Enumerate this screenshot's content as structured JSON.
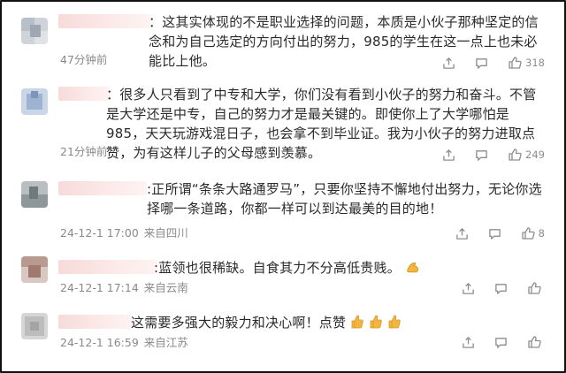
{
  "comments": [
    {
      "prefix": "：",
      "text": "这其实体现的不是职业选择的问题，本质是小伙子那种坚定的信念和为自己选定的方向付出的努力，985的学生在这一点上也未必能比上他。",
      "time": "47分钟前",
      "location": "",
      "likes": "318"
    },
    {
      "prefix": "：",
      "text": "很多人只看到了中专和大学，你们没有看到小伙子的努力和奋斗。不管是大学还是中专，自己的努力才是最关键的。即使你上了大学哪怕是985，天天玩游戏混日子，也会拿不到毕业证。我为小伙子的努力进取点赞，为有这样儿子的父母感到羡慕。",
      "time": "21分钟前",
      "location": "",
      "likes": "249"
    },
    {
      "prefix": ":",
      "text": "正所谓“条条大路通罗马”，只要你坚持不懈地付出努力，无论你选择哪一条道路，你都一样可以到达最美的目的地！",
      "time": "24-12-1 17:00",
      "location": "来自四川",
      "likes": "8"
    },
    {
      "prefix": ":",
      "text": "蓝领也很稀缺。自食其力不分高低贵贱。",
      "time": "24-12-1 17:14",
      "location": "来自云南",
      "likes": ""
    },
    {
      "prefix": "",
      "text": "这需要多强大的毅力和决心啊！点赞",
      "time": "24-12-1 16:59",
      "location": "来自江苏",
      "likes": ""
    }
  ],
  "icons": {
    "share": "share-icon",
    "reply": "comment-icon",
    "like": "thumbs-up-icon",
    "emoji_muscle": "flexed-biceps-emoji",
    "emoji_thumbs": "thumbs-up-emoji"
  },
  "colors": {
    "name_blur": "#f6d9d7",
    "meta": "#8a8a8a",
    "emoji": "#f2b640"
  }
}
